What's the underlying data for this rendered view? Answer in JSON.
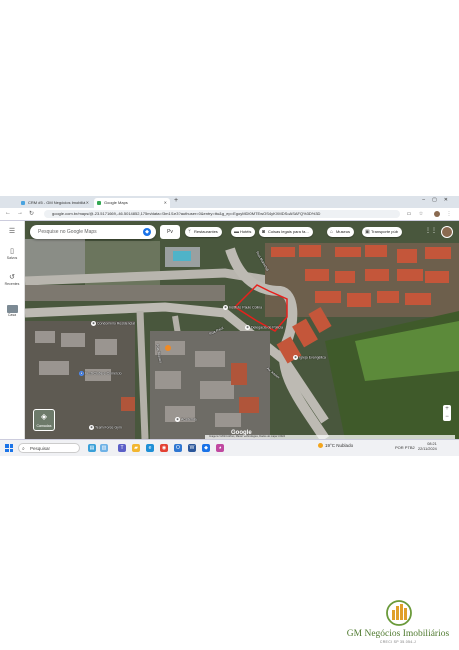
{
  "browser": {
    "tabs": [
      {
        "label": "CRM #5 - GM Negócios Imobiliá",
        "active": false
      },
      {
        "label": "Google Maps",
        "active": true
      }
    ],
    "new_tab_label": "+",
    "url": "google.com.br/maps/@-23.5171669,-46.5014852,175m/data=!3m1!1e3?authuser=0&entry=ttu&g_ep=EgoyMDI0MTEwOS4yKXMDSoASAFQ%3D%3D"
  },
  "maps": {
    "rail": [
      {
        "label": "Menu",
        "icon": "menu-icon"
      },
      {
        "label": "Salvos",
        "icon": "bookmark-icon"
      },
      {
        "label": "Recentes",
        "icon": "history-icon"
      },
      {
        "label": "Casa",
        "icon": "home-icon"
      }
    ],
    "search_placeholder": "Pesquise no Google Maps",
    "directions_label": "Pv",
    "chips": [
      {
        "label": "Restaurantes",
        "icon": "fork-knife-icon"
      },
      {
        "label": "Hotéis",
        "icon": "bed-icon"
      },
      {
        "label": "Coisas legais para fa...",
        "icon": "camera-icon"
      },
      {
        "label": "Museus",
        "icon": "museum-icon"
      },
      {
        "label": "Transporte púb",
        "icon": "bus-icon"
      }
    ],
    "places": [
      {
        "label": "Instituto Paulo Colina"
      },
      {
        "label": "Delegacia de Polícia"
      },
      {
        "label": "Igreja Evangélica"
      },
      {
        "label": "Vesti Clube e Comércio"
      },
      {
        "label": "Team Force Gym"
      },
      {
        "label": "Condomínio Residencial"
      },
      {
        "label": "Academia"
      }
    ],
    "streets": [
      "Rua Marechal",
      "Rua Taquari",
      "Rua Paiol",
      "Av. Xavier"
    ],
    "layers_label": "Camadas",
    "logo": "Google",
    "attribution": "Imagens ©2024 Airbus, Maxar Technologies, Dados do mapa ©2024",
    "zoom_in": "+",
    "zoom_out": "−"
  },
  "taskbar": {
    "search_label": "Pesquisar",
    "weather": "19°C  Nublado",
    "tray_lang": "POR PTB2",
    "time": "08:21",
    "date": "22/11/2024"
  },
  "branding": {
    "name": "GM Negócios Imobiliários",
    "subtitle": "CRECI SP 35.054-J"
  },
  "colors": {
    "accent": "#1a73e8",
    "brand_green": "#4f7a2f",
    "parcel_outline": "#e8201c"
  }
}
